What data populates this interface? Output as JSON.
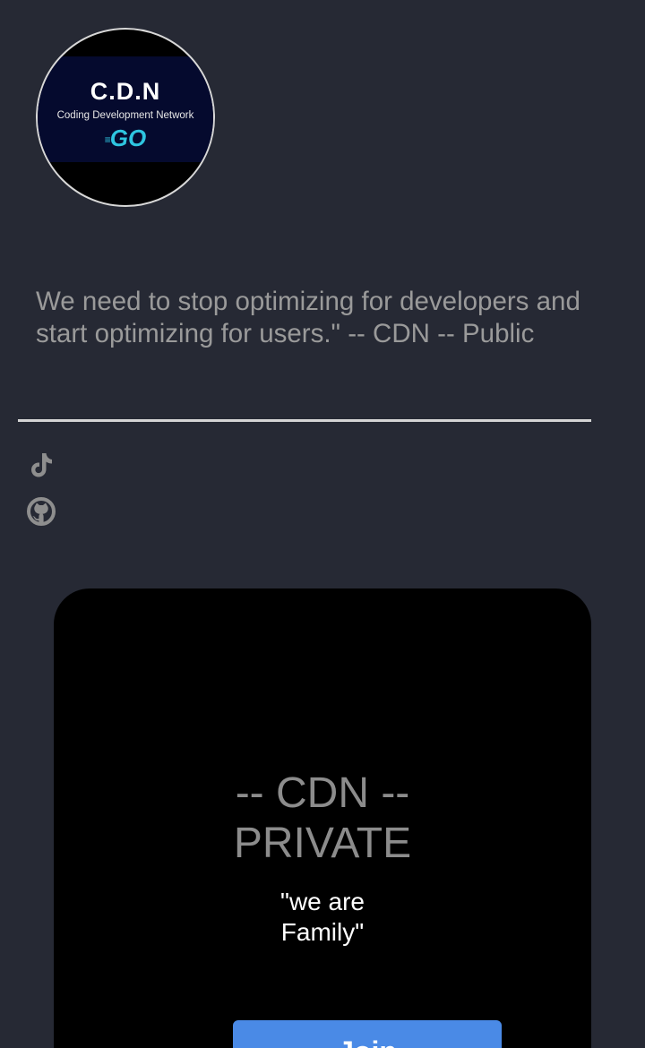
{
  "avatar": {
    "title": "C.D.N",
    "subtitle": "Coding Development Network",
    "badge": "GO"
  },
  "quote": {
    "text": "We need to stop optimizing for developers and start optimizing for users.\" -- CDN -- Public"
  },
  "social": [
    {
      "icon": "tiktok-icon"
    },
    {
      "icon": "github-icon"
    }
  ],
  "card": {
    "title_line1": "-- CDN --",
    "title_line2": "PRIVATE",
    "motto_line1": "\"we are",
    "motto_line2": "Family\"",
    "button_label": "Join"
  },
  "colors": {
    "background": "#262934",
    "card": "#000000",
    "button": "#4a8ae6",
    "logo_accent": "#2ec5e0"
  }
}
